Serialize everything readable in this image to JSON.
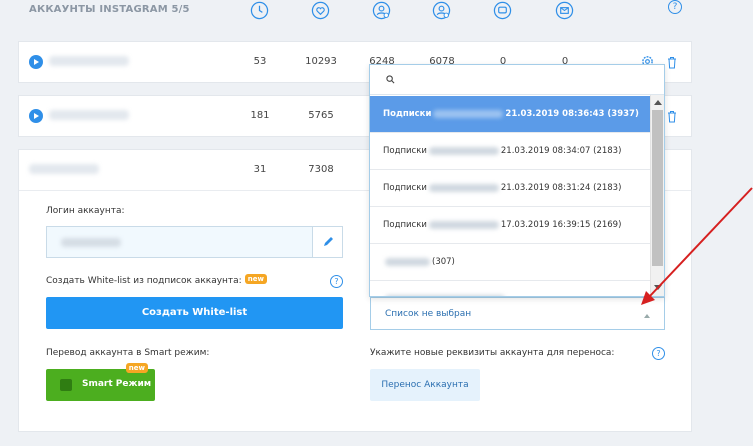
{
  "header": {
    "title": "АККАУНТЫ INSTAGRAM 5/5",
    "help_label": "?"
  },
  "rows": [
    {
      "values": [
        "53",
        "10293",
        "6248",
        "6078",
        "0",
        "0"
      ]
    },
    {
      "values": [
        "181",
        "5765"
      ]
    },
    {
      "values": [
        "31",
        "7308"
      ]
    }
  ],
  "account": {
    "login_label": "Логин аккаунта:",
    "whitelist_label": "Создать White-list из подписок аккаунта:",
    "new_badge": "new",
    "whitelist_button": "Создать White-list",
    "smart_label": "Перевод аккаунта в Smart режим:",
    "smart_button": "Smart Режим",
    "transfer_label": "Укажите новые реквизиты аккаунта для переноса:",
    "transfer_button": "Перенос Аккаунта",
    "select_value": "Список не выбран",
    "help_label": "?"
  },
  "dropdown": {
    "items": [
      {
        "prefix": "Подписки",
        "suffix": "21.03.2019 08:36:43 (3937)",
        "selected": true
      },
      {
        "prefix": "Подписки",
        "suffix": "21.03.2019 08:34:07 (2183)",
        "selected": false
      },
      {
        "prefix": "Подписки",
        "suffix": "21.03.2019 08:31:24 (2183)",
        "selected": false
      },
      {
        "prefix": "Подписки",
        "suffix": "17.03.2019 16:39:15 (2169)",
        "selected": false
      },
      {
        "prefix": "",
        "suffix": "(307)",
        "selected": false
      }
    ]
  },
  "colors": {
    "accent": "#2196f3",
    "selected_item": "#5b9be8",
    "smart_green": "#4cae1f",
    "badge": "#f5a623",
    "annotation_arrow": "#d62020"
  }
}
